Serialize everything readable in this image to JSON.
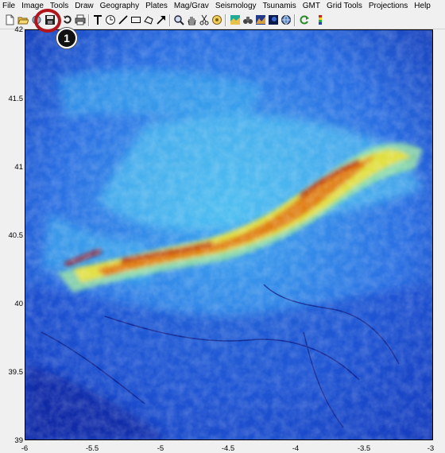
{
  "menu": [
    "File",
    "Image",
    "Tools",
    "Draw",
    "Geography",
    "Plates",
    "Mag/Grav",
    "Seismology",
    "Tsunamis",
    "GMT",
    "Grid Tools",
    "Projections",
    "Help"
  ],
  "toolbar": {
    "tools": [
      "new-file-icon",
      "open-folder-icon",
      "import-icon",
      "save-icon",
      "rotate-icon",
      "print-icon",
      "text-icon",
      "clock-icon",
      "line-icon",
      "rectangle-icon",
      "polygon-icon",
      "arrow-icon",
      "zoom-icon",
      "pan-hand-icon",
      "scissors-icon",
      "info-icon",
      "image-map-icon",
      "binoculars-icon",
      "shaded-relief-icon",
      "dark-image-icon",
      "globe-icon",
      "refresh-icon",
      "color-bar-icon"
    ]
  },
  "callout": {
    "number": "1",
    "color": "#b0151b"
  },
  "plot": {
    "y_ticks": [
      "42",
      "41.5",
      "41",
      "40.5",
      "40",
      "39.5",
      "39"
    ],
    "x_ticks": [
      "-6",
      "-5.5",
      "-5",
      "-4.5",
      "-4",
      "-3.5",
      "-3"
    ],
    "xlim": [
      -6,
      -3
    ],
    "ylim": [
      39,
      42
    ],
    "colormap": [
      "#08108a",
      "#1f3fd8",
      "#2f7ff0",
      "#3fc0f0",
      "#9fe8a0",
      "#f0e030",
      "#e07010",
      "#b01010"
    ]
  }
}
